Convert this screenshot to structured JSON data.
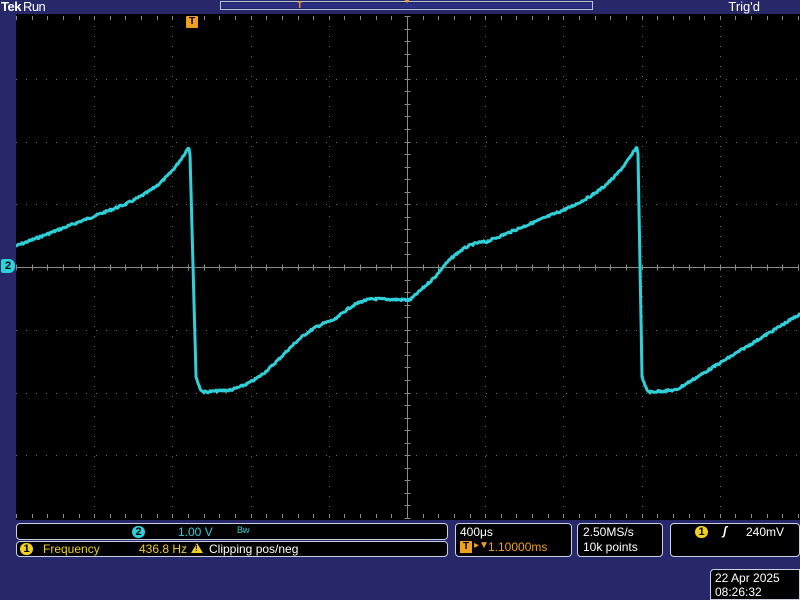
{
  "header": {
    "brand": "Tek",
    "run_state": "Run",
    "trigger_state": "Trig'd",
    "record_trigger_marker": "T"
  },
  "plot": {
    "trigger_marker": "T",
    "channel_marker": "2",
    "grid_divisions": {
      "horizontal": 10,
      "vertical": 8
    },
    "trace_color": "#2fd0d8",
    "background": "#000000",
    "grid_color": "#6a6a6a"
  },
  "channel": {
    "number": "2",
    "scale": "1.00 V",
    "bw_icon": "B̵w"
  },
  "measurement": {
    "badge": "1",
    "name": "Frequency",
    "value": "436.8 Hz",
    "warning": "Clipping pos/neg",
    "warning_icon": "!"
  },
  "timebase": {
    "per_div": "400μs",
    "trig_badge": "T",
    "arrow": "▸▼",
    "position": "1.10000ms"
  },
  "acquisition": {
    "sample_rate": "2.50MS/s",
    "record_length": "10k points"
  },
  "trigger": {
    "source": "1",
    "slope": "ʃ",
    "level": "240mV"
  },
  "clock": {
    "date": "22 Apr 2025",
    "time": "08:26:32"
  },
  "colors": {
    "frame_bg": "#27286a",
    "ch2": "#2fd0d8",
    "ch1": "#f0d020",
    "trigger": "#f0a020"
  },
  "icons": [
    "trigger-marker-icon",
    "channel-2-marker-icon",
    "warning-icon",
    "trigger-slope-icon",
    "bandwidth-limit-icon"
  ]
}
